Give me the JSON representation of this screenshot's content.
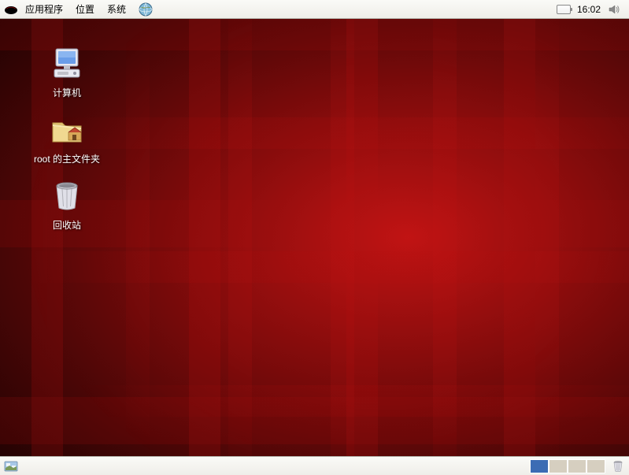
{
  "top_panel": {
    "menus": {
      "applications": "应用程序",
      "places": "位置",
      "system": "系统"
    },
    "clock": "16:02"
  },
  "desktop_icons": {
    "computer": {
      "label": "计算机"
    },
    "home": {
      "label": "root 的主文件夹"
    },
    "trash": {
      "label": "回收站"
    }
  },
  "workspaces": {
    "count": 4,
    "active_index": 0
  },
  "colors": {
    "panel_bg_top": "#fafaf7",
    "panel_bg_bottom": "#efeee9",
    "workspace_active": "#3c6cb4",
    "workspace_inactive": "#d6cfc0",
    "desktop_red_dark": "#2a0000",
    "desktop_red_light": "#8f1010"
  }
}
